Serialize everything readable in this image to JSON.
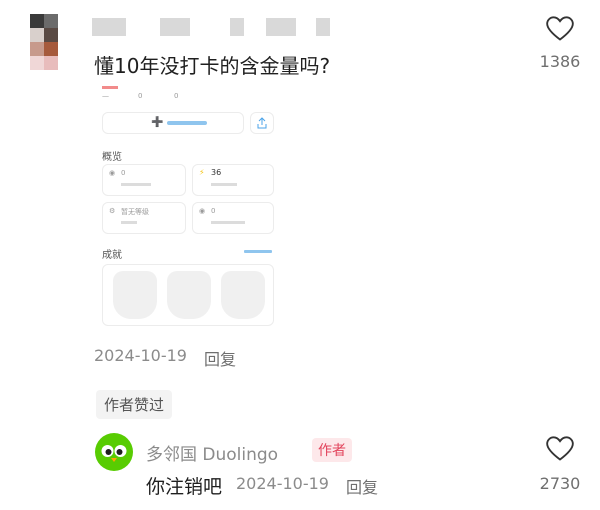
{
  "comment": {
    "question": "懂10年没打卡的含金量吗?",
    "like_count": "1386",
    "date": "2024-10-19",
    "reply_label": "回复",
    "author_liked_label": "作者赞过"
  },
  "embedded_screenshot": {
    "overview_label": "概览",
    "streak_value": "0",
    "xp_value": "36",
    "league_value": "暂无等级",
    "rank_value": "0",
    "achievements_label": "成就"
  },
  "reply": {
    "username": "多邻国 Duolingo",
    "author_badge": "作者",
    "text": "你注销吧",
    "date": "2024-10-19",
    "reply_label": "回复",
    "like_count": "2730"
  },
  "colors": {
    "accent_red": "#e2445c",
    "duolingo_green": "#58cc02"
  }
}
